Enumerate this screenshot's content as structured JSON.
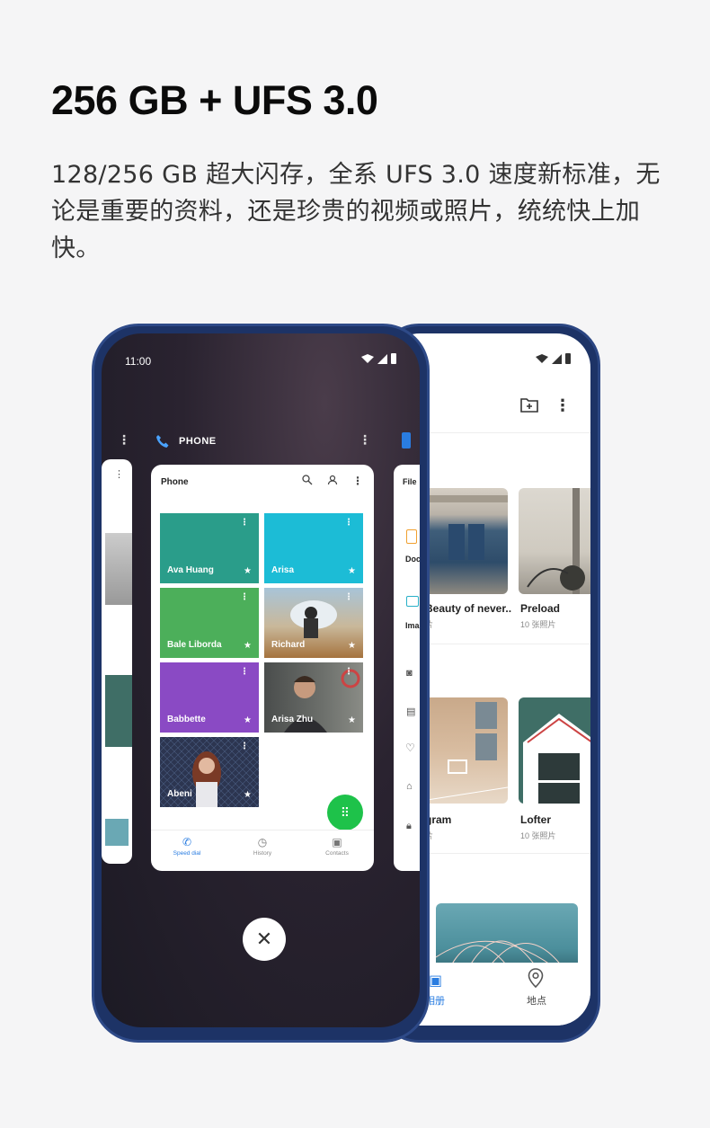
{
  "headline": "256 GB + UFS 3.0",
  "description": "128/256 GB 超大闪存，全系 UFS 3.0 速度新标准，无论是重要的资料，还是珍贵的视频或照片，统统快上加快。",
  "front_phone": {
    "status_time": "11:00",
    "recent_app_label": "PHONE",
    "card": {
      "title": "Phone",
      "contacts": [
        {
          "name": "Ava Huang",
          "color": "#2a9d8a"
        },
        {
          "name": "Arisa",
          "color": "#1cbcd6"
        },
        {
          "name": "Bale Liborda",
          "color": "#4caf5a"
        },
        {
          "name": "Richard",
          "color": "#b28a5a"
        },
        {
          "name": "Babbette",
          "color": "#8a4ac4"
        },
        {
          "name": "Arisa Zhu",
          "color": "#5a5f5a"
        },
        {
          "name": "Abeni",
          "color": "#2c3550"
        }
      ],
      "nav": [
        {
          "label": "Speed dial",
          "icon": "phone-icon",
          "active": true
        },
        {
          "label": "History",
          "icon": "clock-icon",
          "active": false
        },
        {
          "label": "Contacts",
          "icon": "contact-icon",
          "active": false
        }
      ]
    },
    "side_card_right_title": "File",
    "side_items": [
      "Doc",
      "Ima"
    ]
  },
  "back_phone": {
    "albums": [
      {
        "name": "Beauty of never..",
        "count": "片"
      },
      {
        "name": "Preload",
        "count": "10 张照片"
      },
      {
        "name": "gram",
        "count": "片"
      },
      {
        "name": "Lofter",
        "count": "10 张照片"
      }
    ],
    "nav": [
      {
        "label": "相册",
        "icon": "album-icon"
      },
      {
        "label": "地点",
        "icon": "location-pin-icon"
      }
    ]
  },
  "colors": {
    "accent": "#2a7de1",
    "fab": "#1ec24a",
    "phone_frame": "#1d3366"
  }
}
